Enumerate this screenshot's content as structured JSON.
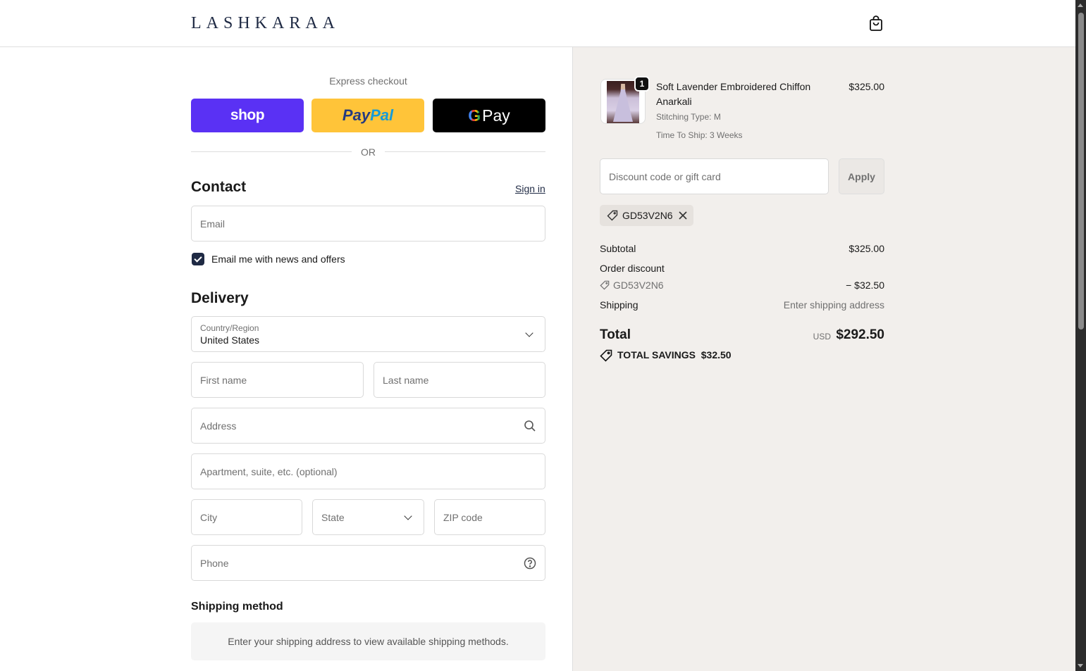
{
  "header": {
    "logo": "LASHKARAA",
    "cart_icon": "shopping-bag-icon"
  },
  "express": {
    "label": "Express checkout",
    "shop_label": "shop",
    "paypal_part1": "Pay",
    "paypal_part2": "Pal",
    "gpay_g": "G",
    "gpay_label": "Pay",
    "or_label": "OR"
  },
  "contact": {
    "title": "Contact",
    "sign_in": "Sign in",
    "email_placeholder": "Email",
    "newsletter_checked": true,
    "newsletter_label": "Email me with news and offers"
  },
  "delivery": {
    "title": "Delivery",
    "country_label": "Country/Region",
    "country_value": "United States",
    "first_name_placeholder": "First name",
    "last_name_placeholder": "Last name",
    "address_placeholder": "Address",
    "apartment_placeholder": "Apartment, suite, etc. (optional)",
    "city_placeholder": "City",
    "state_placeholder": "State",
    "zip_placeholder": "ZIP code",
    "phone_placeholder": "Phone"
  },
  "shipping_method": {
    "title": "Shipping method",
    "notice": "Enter your shipping address to view available shipping methods."
  },
  "summary": {
    "item": {
      "quantity": "1",
      "name": "Soft Lavender Embroidered Chiffon Anarkali",
      "stitching": "Stitching Type: M",
      "ship_time": "Time To Ship: 3 Weeks",
      "price": "$325.00"
    },
    "discount_placeholder": "Discount code or gift card",
    "apply_label": "Apply",
    "applied_code": "GD53V2N6",
    "subtotal_label": "Subtotal",
    "subtotal_value": "$325.00",
    "order_discount_label": "Order discount",
    "order_discount_code": "GD53V2N6",
    "order_discount_value": "− $32.50",
    "shipping_label": "Shipping",
    "shipping_value": "Enter shipping address",
    "total_label": "Total",
    "total_currency": "USD",
    "total_value": "$292.50",
    "savings_label": "TOTAL SAVINGS",
    "savings_value": "$32.50"
  },
  "colors": {
    "shop_purple": "#5a31f4",
    "paypal_yellow": "#ffc439",
    "brand_navy": "#1f2a44",
    "summary_bg": "#f2efec"
  }
}
